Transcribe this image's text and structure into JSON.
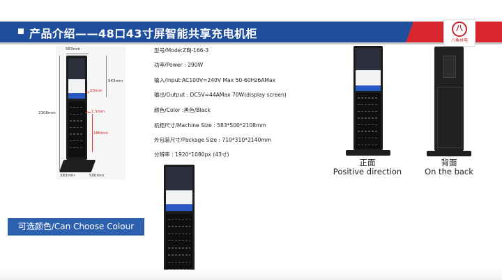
{
  "header": {
    "title": "产品介绍——48口43寸屏智能共享充电机柜",
    "logo_text": "八鱼共电"
  },
  "diagram": {
    "width_top": "583mm",
    "height_total": "2108mm",
    "height_screen": "943mm",
    "gap_20": "20mm",
    "gap_15": "1.5mm",
    "h_186": "186mm",
    "base_depth": "383mm",
    "base_width": "500mm"
  },
  "specs": [
    "型号/Mode:ZBJ-166-3",
    "功率/Power : 290W",
    "输入/Input:AC100V=240V Max    50-60Hz6AMax",
    "输出/Output : DC5V=44AMax   70W(display screen)",
    "颜色/Color :黑色/Black",
    "机柜尺寸/Machine Size  : 583*500*2108mm",
    "外包装尺寸/Package Size  : 710*310*2140mm",
    "分辨率 : 1920*1080px (43寸)"
  ],
  "front": {
    "cn": "正面",
    "en": "Positive direction"
  },
  "back": {
    "cn": "背面",
    "en": "On the back"
  },
  "colour_button": "可选颜色/Can Choose Colour",
  "colors": {
    "banner": "#1f4f9c",
    "accent_red": "#d8262e",
    "button": "#2d61b0"
  }
}
